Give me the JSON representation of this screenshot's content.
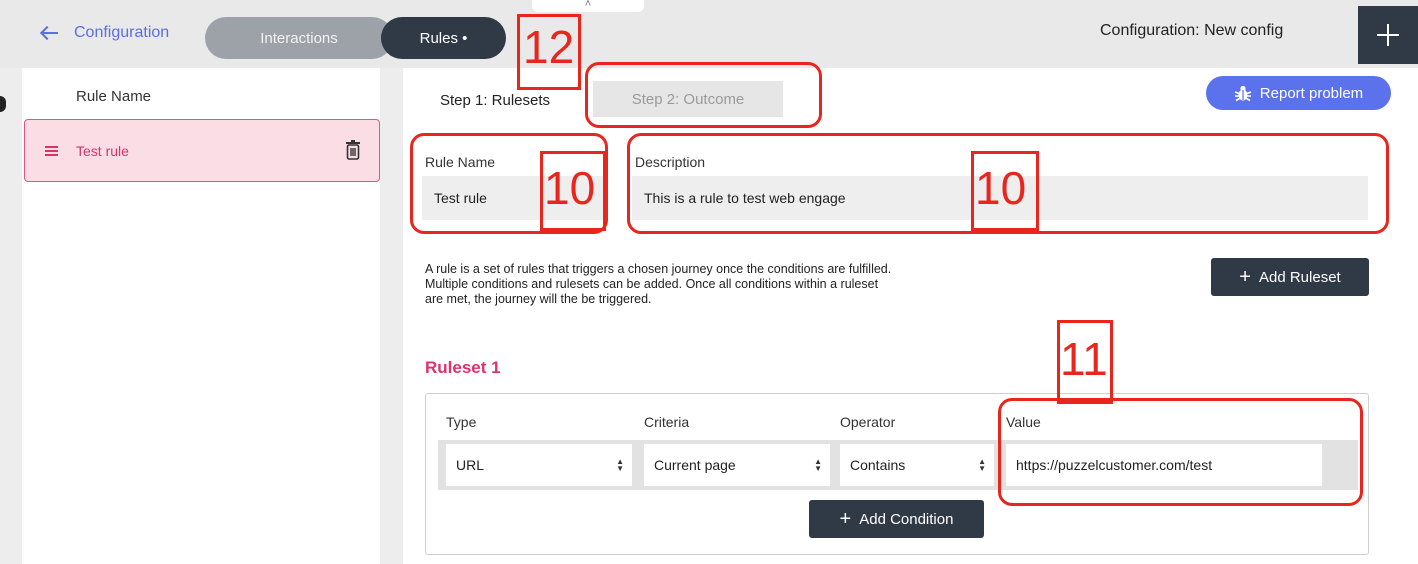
{
  "topbar": {
    "back_label": "Configuration",
    "tabs": [
      {
        "label": "Interactions"
      },
      {
        "label": "Rules •"
      }
    ],
    "config_title": "Configuration: New config",
    "handle_glyph": "˄"
  },
  "sidebar": {
    "heading": "Rule Name",
    "items": [
      {
        "label": "Test rule"
      }
    ]
  },
  "main": {
    "step_tabs": [
      {
        "label": "Step 1: Rulesets"
      },
      {
        "label": "Step 2: Outcome"
      }
    ],
    "report_button": "Report problem",
    "rule_name_label": "Rule Name",
    "rule_name_value": "Test rule",
    "description_label": "Description",
    "description_value": "This is a rule to test web engage",
    "help_text": "A rule is a set of rules that triggers a chosen journey once the conditions are fulfilled. Multiple conditions and rulesets can be added. Once all conditions within a ruleset are met, the journey will the be triggered.",
    "add_ruleset_label": "Add Ruleset",
    "ruleset_title": "Ruleset 1",
    "condition_headers": [
      "Type",
      "Criteria",
      "Operator",
      "Value"
    ],
    "condition": {
      "type": "URL",
      "criteria": "Current page",
      "operator": "Contains",
      "value": "https://puzzelcustomer.com/test"
    },
    "add_condition_label": "Add Condition"
  },
  "annotations": {
    "n10a": "10",
    "n10b": "10",
    "n11": "11",
    "n12": "12"
  },
  "colors": {
    "accent_pink": "#e0306f",
    "dark": "#2f3a46",
    "report_blue": "#5b72ec",
    "link_blue": "#5a6fe0",
    "annotation_red": "#e8261e"
  }
}
